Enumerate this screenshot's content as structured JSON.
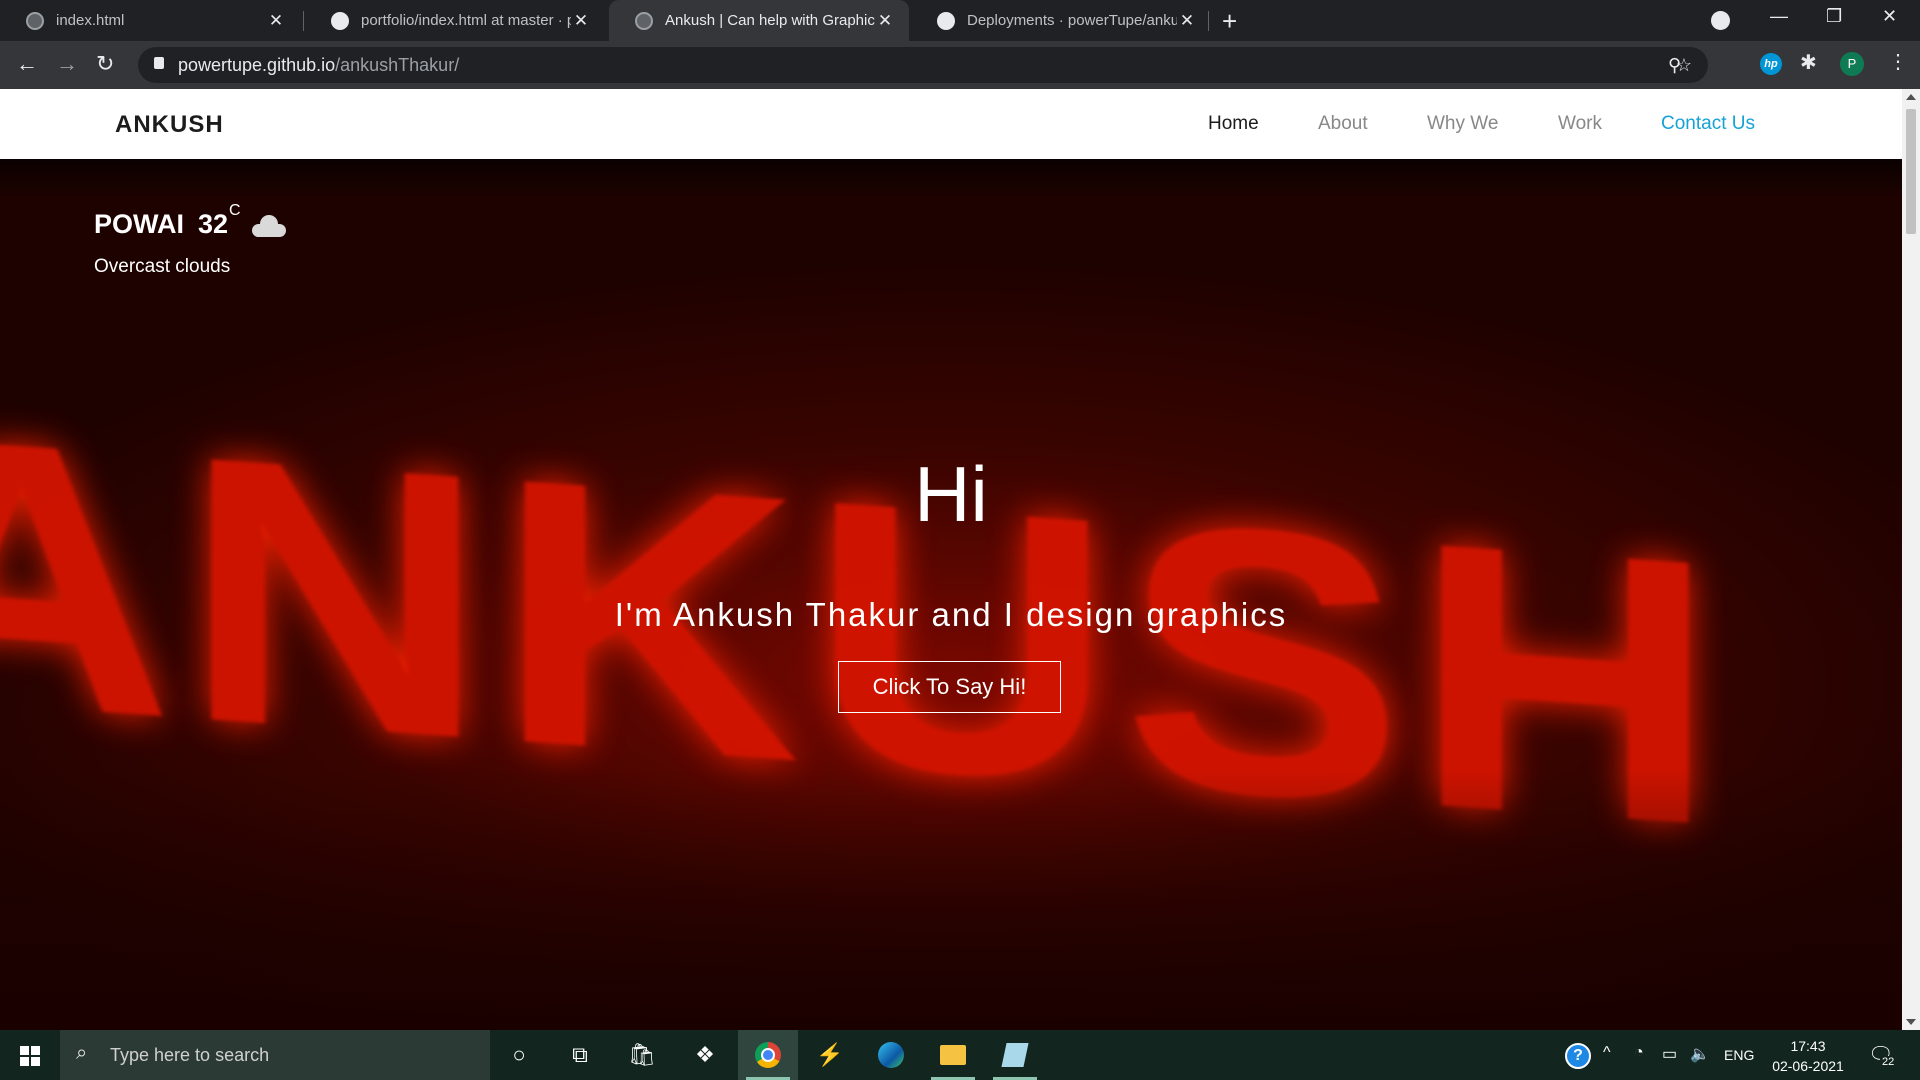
{
  "browser": {
    "tabs": [
      {
        "title": "index.html",
        "icon": "globe-icon"
      },
      {
        "title": "portfolio/index.html at master · p",
        "icon": "github-icon"
      },
      {
        "title": "Ankush | Can help with Graphic",
        "icon": "globe-icon",
        "active": true
      },
      {
        "title": "Deployments · powerTupe/ankus",
        "icon": "github-icon"
      }
    ],
    "url_host": "powertupe.github.io",
    "url_path": "/ankushThakur/",
    "profile_initial": "P",
    "hp_label": "hp"
  },
  "site": {
    "brand": "ANKUSH",
    "nav": [
      {
        "label": "Home"
      },
      {
        "label": "About"
      },
      {
        "label": "Why We"
      },
      {
        "label": "Work"
      },
      {
        "label": "Contact Us"
      }
    ],
    "weather": {
      "city": "POWAI",
      "temp": "32",
      "unit": "C",
      "description": "Overcast clouds",
      "icon": "cloud-icon"
    },
    "hero": {
      "background_text": "ANKUSH",
      "greeting": "Hi",
      "tagline": "I'm Ankush Thakur and I design graphics",
      "cta": "Click To Say Hi!"
    },
    "colors": {
      "accent": "#17a2d6",
      "hero_red": "#d41400",
      "hero_bg": "#2a0300"
    }
  },
  "taskbar": {
    "search_placeholder": "Type here to search",
    "language": "ENG",
    "time": "17:43",
    "date": "02-06-2021",
    "notification_count": "22"
  }
}
